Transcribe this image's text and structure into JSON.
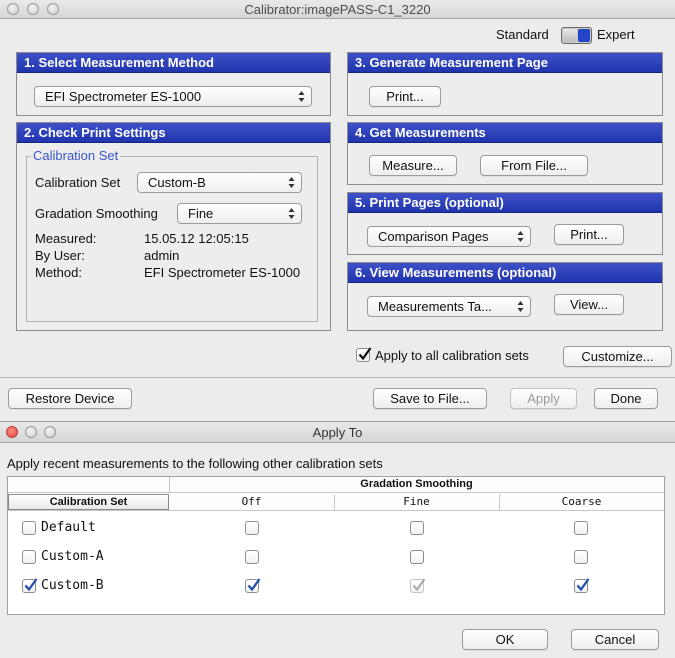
{
  "window": {
    "title": "Calibrator:imagePASS-C1_3220"
  },
  "mode": {
    "standard": "Standard",
    "expert": "Expert"
  },
  "sections": {
    "s1": {
      "title": "1. Select Measurement Method",
      "device": "EFI Spectrometer ES-1000"
    },
    "s2": {
      "title": "2. Check Print Settings",
      "group": "Calibration Set",
      "calset_label": "Calibration Set",
      "calset_value": "Custom-B",
      "smoothing_label": "Gradation Smoothing",
      "smoothing_value": "Fine",
      "measured_label": "Measured:",
      "measured_value": "15.05.12 12:05:15",
      "byuser_label": "By User:",
      "byuser_value": "admin",
      "method_label": "Method:",
      "method_value": "EFI Spectrometer ES-1000"
    },
    "s3": {
      "title": "3. Generate Measurement Page",
      "print": "Print..."
    },
    "s4": {
      "title": "4. Get Measurements",
      "measure": "Measure...",
      "from_file": "From File..."
    },
    "s5": {
      "title": "5. Print Pages (optional)",
      "popup": "Comparison Pages",
      "print": "Print..."
    },
    "s6": {
      "title": "6. View Measurements (optional)",
      "popup": "Measurements Ta...",
      "view": "View..."
    }
  },
  "apply_all": {
    "label": "Apply to all calibration sets",
    "checked": true,
    "customize": "Customize..."
  },
  "bottom_bar": {
    "restore": "Restore Device",
    "save": "Save to File...",
    "apply": "Apply",
    "done": "Done"
  },
  "dialog": {
    "title": "Apply To",
    "prompt": "Apply recent measurements to the following other calibration sets",
    "group_header": "Gradation Smoothing",
    "columns": [
      "Calibration Set",
      "Off",
      "Fine",
      "Coarse"
    ],
    "rows": [
      {
        "name": "Default",
        "checked": false,
        "off": false,
        "fine": false,
        "coarse": false
      },
      {
        "name": "Custom-A",
        "checked": false,
        "off": false,
        "fine": false,
        "coarse": false
      },
      {
        "name": "Custom-B",
        "checked": true,
        "off": true,
        "fine": "disabled-checked",
        "coarse": true
      }
    ],
    "ok": "OK",
    "cancel": "Cancel"
  },
  "colors": {
    "panel_header": "#2a3fbd",
    "check_blue": "#1e4fa8"
  }
}
